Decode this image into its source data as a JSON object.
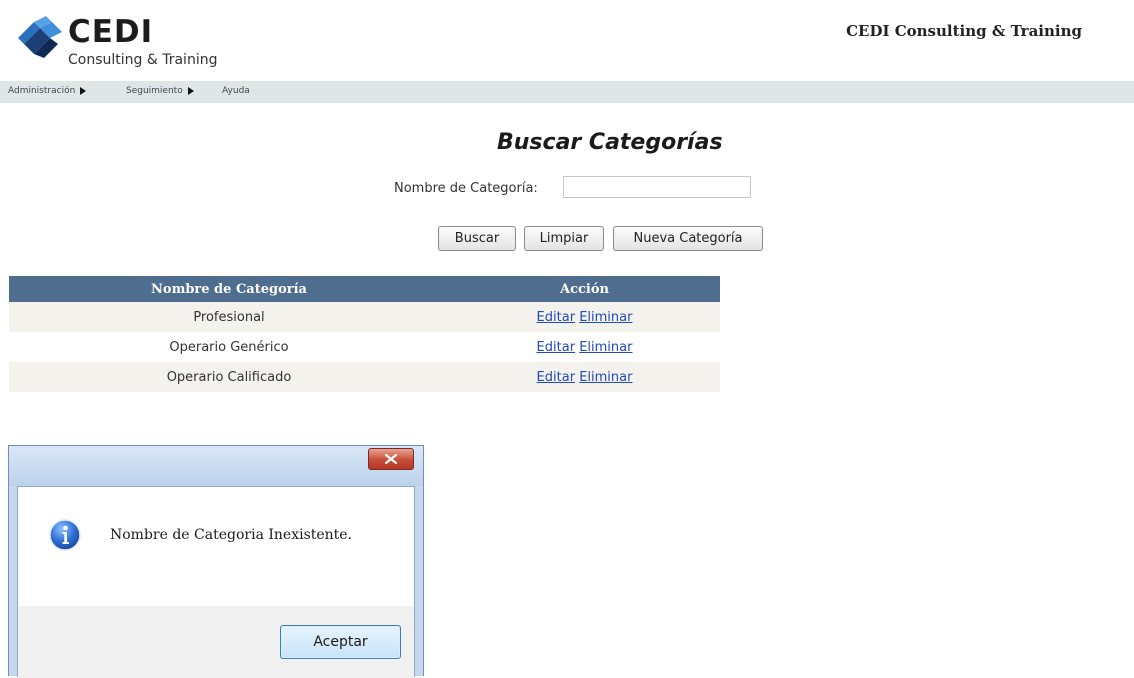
{
  "header": {
    "logo_big": "CEDI",
    "logo_sub": "Consulting & Training",
    "company_name": "CEDI Consulting & Training"
  },
  "menu": [
    {
      "label": "Administración",
      "has_submenu": true
    },
    {
      "label": "Seguimiento",
      "has_submenu": true
    },
    {
      "label": "Ayuda",
      "has_submenu": false
    }
  ],
  "form": {
    "title": "Buscar Categorías",
    "field_label": "Nombre de Categoría:",
    "field_value": "",
    "buttons": {
      "search": "Buscar",
      "clear": "Limpiar",
      "new": "Nueva Categoría"
    }
  },
  "table": {
    "headers": [
      "Nombre de Categoría",
      "Acción"
    ],
    "rows": [
      {
        "name": "Profesional",
        "edit": "Editar",
        "delete": "Eliminar"
      },
      {
        "name": "Operario Genérico",
        "edit": "Editar",
        "delete": "Eliminar"
      },
      {
        "name": "Operario Calificado",
        "edit": "Editar",
        "delete": "Eliminar"
      }
    ],
    "colors": {
      "header_bg": "#4f6e8f",
      "stripe": "#f4f2ec",
      "link": "#2249c0"
    }
  },
  "dialog": {
    "close_glyph": "x",
    "message": "Nombre de Categoria Inexistente.",
    "ok_label": "Aceptar",
    "icon": "info-icon"
  }
}
